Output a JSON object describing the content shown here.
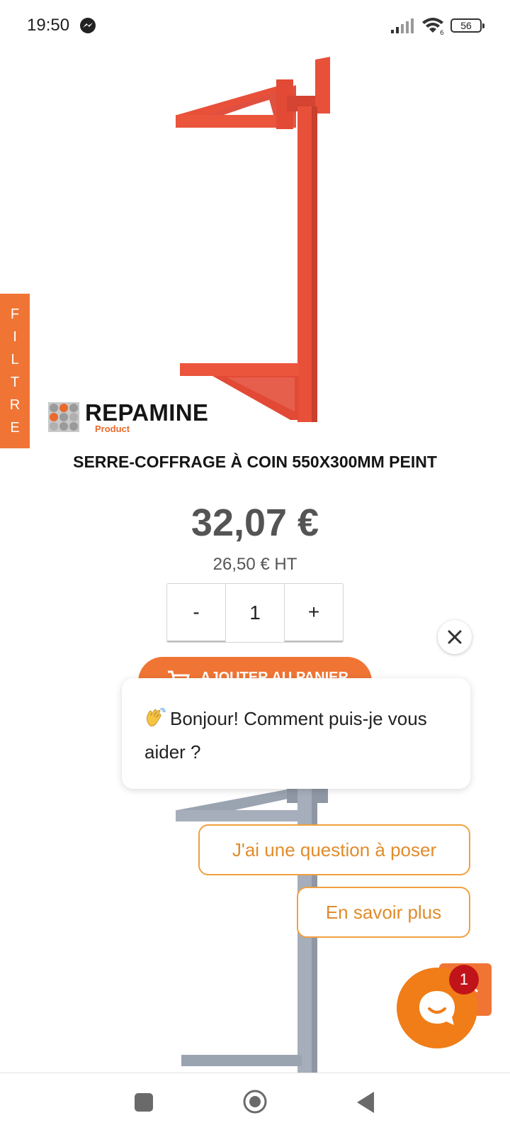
{
  "status_bar": {
    "time": "19:50",
    "battery": "56"
  },
  "filter_tab": {
    "letters": [
      "F",
      "I",
      "L",
      "T",
      "R",
      "E"
    ]
  },
  "brand": {
    "name": "REPAMINE",
    "sub": "Product"
  },
  "product": {
    "title": "SERRE-COFFRAGE À COIN 550X300MM PEINT",
    "price": "32,07 €",
    "price_ht": "26,50 € HT",
    "quantity": "1",
    "minus_label": "-",
    "plus_label": "+",
    "add_to_cart_label": "AJOUTER AU PANIER"
  },
  "chat": {
    "message": "Bonjour! Comment puis-je vous aider ?",
    "replies": [
      "J'ai une question à poser",
      "En savoir plus"
    ],
    "unread_count": "1"
  },
  "colors": {
    "accent": "#f07535",
    "chat_orange": "#f07d17",
    "badge_red": "#c0141a",
    "reply_border": "#f0a040",
    "product_red": "#e8503a"
  },
  "icons": [
    "messenger-icon",
    "signal-icon",
    "wifi-icon",
    "battery-icon",
    "close-icon",
    "wave-icon",
    "cart-icon",
    "chat-icon",
    "chevron-up-icon",
    "square-icon",
    "circle-icon",
    "back-icon"
  ]
}
